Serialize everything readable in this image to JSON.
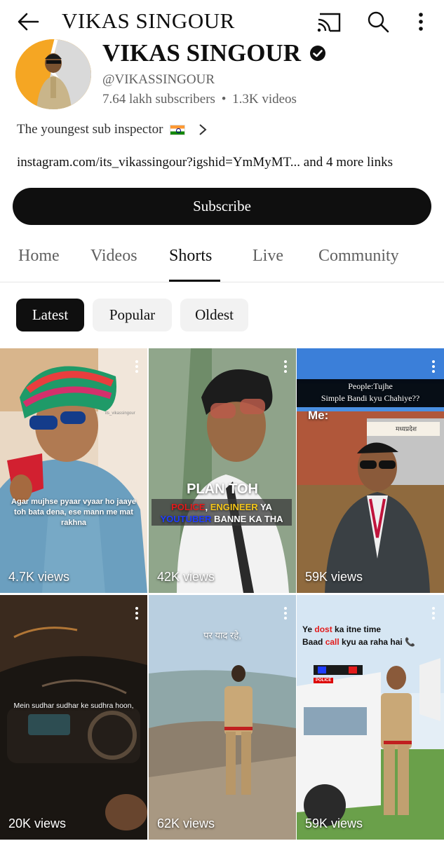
{
  "appbar": {
    "title": "VIKAS SINGOUR",
    "icons": [
      "back-arrow-icon",
      "cast-icon",
      "search-icon",
      "more-vert-icon"
    ]
  },
  "channel": {
    "name": "VIKAS SINGOUR",
    "handle": "@VIKASSINGOUR",
    "subscribers": "7.64 lakh subscribers",
    "separator": "•",
    "videos": "1.3K videos",
    "description": "The youngest sub inspector",
    "links": "instagram.com/its_vikassingour?igshid=YmMyMT... and 4 more links",
    "subscribe_label": "Subscribe"
  },
  "tabs": [
    {
      "label": "Home"
    },
    {
      "label": "Videos"
    },
    {
      "label": "Shorts",
      "active": true
    },
    {
      "label": "Live"
    },
    {
      "label": "Community"
    }
  ],
  "chips": [
    {
      "label": "Latest",
      "active": true
    },
    {
      "label": "Popular"
    },
    {
      "label": "Oldest"
    }
  ],
  "shorts": [
    {
      "views": "4.7K views",
      "caption": "Agar mujhse pyaar vyaar ho jaaye toh bata dena, ese mann me mat rakhna",
      "watermark": "its_vikassingour"
    },
    {
      "views": "42K views",
      "caption_title": "PLAN TOH",
      "caption_line1_a": "POLICE",
      "caption_line1_b": ", ",
      "caption_line1_c": "ENGINEER",
      "caption_line1_d": " YA",
      "caption_line2_a": "YOUTUBER",
      "caption_line2_b": " BANNE KA THA"
    },
    {
      "views": "59K views",
      "caption_line1": "People:Tujhe",
      "caption_line2": "Simple Bandi kyu Chahiye??",
      "caption_me": "Me:",
      "sign_text": "मध्यप्रदेश"
    },
    {
      "views": "20K views",
      "caption": "Mein sudhar sudhar ke sudhra hoon,"
    },
    {
      "views": "62K views",
      "caption": "पर याद रहे,"
    },
    {
      "views": "59K views",
      "caption_a": "Ye ",
      "caption_b": "dost",
      "caption_c": " ka itne time",
      "caption_d": "Baad ",
      "caption_e": "call",
      "caption_f": " kyu aa raha hai 📞",
      "badge": "POLICE"
    }
  ],
  "colors": {
    "text_primary": "#0f0f0f",
    "text_secondary": "#606060",
    "chip_bg": "#f2f2f2",
    "caption_red": "#e31b1b",
    "caption_yellow": "#f5c518",
    "caption_blue": "#1e3cff"
  }
}
